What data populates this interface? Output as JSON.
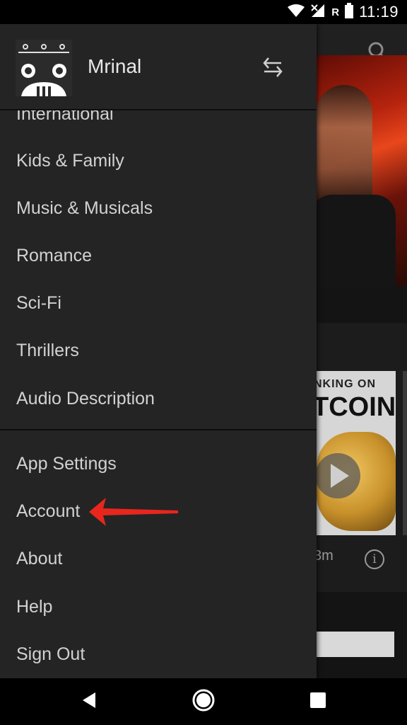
{
  "status_bar": {
    "time": "11:19",
    "network_label": "R",
    "icons": [
      "wifi-icon",
      "signal-off-icon",
      "battery-icon"
    ]
  },
  "background": {
    "tile_title_line1": "NKING ON",
    "tile_title_line2": "TCOIN",
    "duration": "3m",
    "info_glyph": "i",
    "icons": [
      "search-icon",
      "play-icon",
      "info-icon"
    ]
  },
  "drawer": {
    "profile_name": "Mrinal",
    "switch_icon": "switch-profile-icon",
    "categories": [
      {
        "label": "International"
      },
      {
        "label": "Kids & Family"
      },
      {
        "label": "Music & Musicals"
      },
      {
        "label": "Romance"
      },
      {
        "label": "Sci-Fi"
      },
      {
        "label": "Thrillers"
      },
      {
        "label": "Audio Description"
      }
    ],
    "settings": [
      {
        "label": "App Settings"
      },
      {
        "label": "Account"
      },
      {
        "label": "About"
      },
      {
        "label": "Help"
      },
      {
        "label": "Sign Out"
      }
    ]
  },
  "annotation": {
    "arrow_color": "#e8261d"
  },
  "nav_bar": {
    "icons": [
      "back-icon",
      "home-icon",
      "recents-icon"
    ]
  },
  "colors": {
    "drawer_bg": "#242424",
    "menu_text": "#d2d2d2",
    "divider": "#0e0e0e"
  }
}
